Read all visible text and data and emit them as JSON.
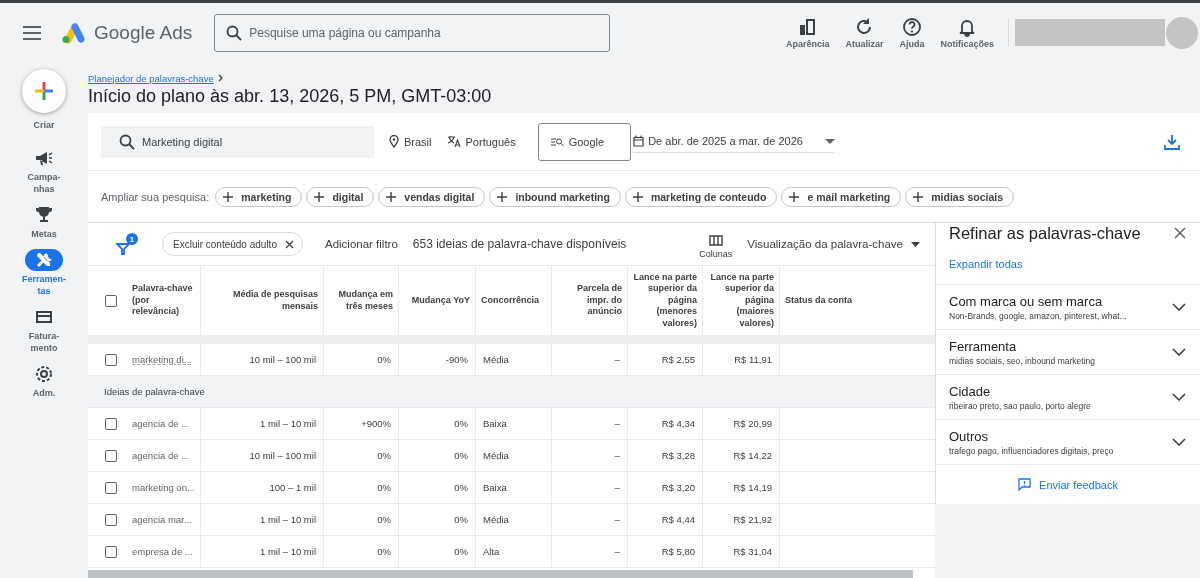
{
  "topbar": {
    "product_name": "Google Ads",
    "search": {
      "placeholder": "Pesquise uma página ou campanha"
    },
    "actions": [
      {
        "kind": "appearance",
        "label": "Aparência"
      },
      {
        "kind": "refresh",
        "label": "Atualizar"
      },
      {
        "kind": "help",
        "label": "Ajuda"
      },
      {
        "kind": "notifications",
        "label": "Notificações"
      }
    ]
  },
  "nav": {
    "create_label": "Criar",
    "items": [
      {
        "kind": "campaigns",
        "label": "Campa-\nnhas",
        "selected": false
      },
      {
        "kind": "goals",
        "label": "Metas",
        "selected": false
      },
      {
        "kind": "tools",
        "label": "Ferramen-\ntas",
        "selected": true
      },
      {
        "kind": "billing",
        "label": "Fatura-\nmento",
        "selected": false
      },
      {
        "kind": "admin",
        "label": "Adm.",
        "selected": false
      }
    ]
  },
  "breadcrumb": "Planejador de palavras-chave",
  "page_title": "Início do plano às abr. 13, 2026, 5 PM, GMT-03:00",
  "query": {
    "keyword": "Marketing digital",
    "location": "Brasil",
    "language": "Português",
    "network": "Google",
    "date_range": "De abr. de 2025 a mar. de 2026"
  },
  "broaden": {
    "label": "Ampliar sua pesquisa:",
    "chips": [
      "marketing",
      "digital",
      "vendas digital",
      "inbound marketing",
      "marketing de conteudo",
      "e mail marketing",
      "midias sociais"
    ]
  },
  "toolbar": {
    "filter_count": "1",
    "filter_chip": "Excluir conteúdo adulto",
    "add_filter": "Adicionar filtro",
    "ideas_count": "653 ideias de palavra-chave disponíveis",
    "columns_label": "Colunas",
    "view": "Visualização da palavra-chave"
  },
  "table": {
    "select_all_checked": false,
    "columns": [
      "Palavra-chave (por relevância)",
      "Média de pesquisas mensais",
      "Mudança em três meses",
      "Mudança YoY",
      "Concorrência",
      "Parcela de impr. do anúncio",
      "Lance na parte superior da página (menores valores)",
      "Lance na parte superior da página (maiores valores)",
      "Status da conta"
    ],
    "searched_rows": [
      {
        "checked": false,
        "cells": [
          "marketing di...",
          "10 mil – 100 mil",
          "0%",
          "-90%",
          "Média",
          "–",
          "R$ 2,55",
          "R$ 11,91",
          ""
        ]
      }
    ],
    "section_title": "Ideias de palavra-chave",
    "idea_rows": [
      {
        "checked": false,
        "cells": [
          "agencia de ...",
          "1 mil – 10 mil",
          "+900%",
          "0%",
          "Baixa",
          "–",
          "R$ 4,34",
          "R$ 20,99",
          ""
        ]
      },
      {
        "checked": false,
        "cells": [
          "agencia de ...",
          "10 mil – 100 mil",
          "0%",
          "0%",
          "Média",
          "–",
          "R$ 3,28",
          "R$ 14,22",
          ""
        ]
      },
      {
        "checked": false,
        "cells": [
          "marketing on...",
          "100 – 1 mil",
          "0%",
          "0%",
          "Baixa",
          "–",
          "R$ 3,20",
          "R$ 14,19",
          ""
        ]
      },
      {
        "checked": false,
        "cells": [
          "agencia mar...",
          "1 mil – 10 mil",
          "0%",
          "0%",
          "Média",
          "–",
          "R$ 4,44",
          "R$ 21,92",
          ""
        ]
      },
      {
        "checked": false,
        "cells": [
          "empresa de ...",
          "1 mil – 10 mil",
          "0%",
          "0%",
          "Alta",
          "–",
          "R$ 5,80",
          "R$ 31,04",
          ""
        ]
      }
    ]
  },
  "refine": {
    "title": "Refinar as palavras-chave",
    "expand_all": "Expandir todas",
    "groups": [
      {
        "title": "Com marca ou sem marca",
        "summary": "Non-Brands, google, amazon, pinterest, what...",
        "expanded": false
      },
      {
        "title": "Ferramenta",
        "summary": "midias sociais, seo, inbound marketing",
        "expanded": false
      },
      {
        "title": "Cidade",
        "summary": "ribeirao preto, sao paulo, porto alegre",
        "expanded": false
      },
      {
        "title": "Outros",
        "summary": "trafego pago, influenciadores digitais, preço",
        "expanded": false
      }
    ],
    "feedback": "Enviar feedback"
  }
}
